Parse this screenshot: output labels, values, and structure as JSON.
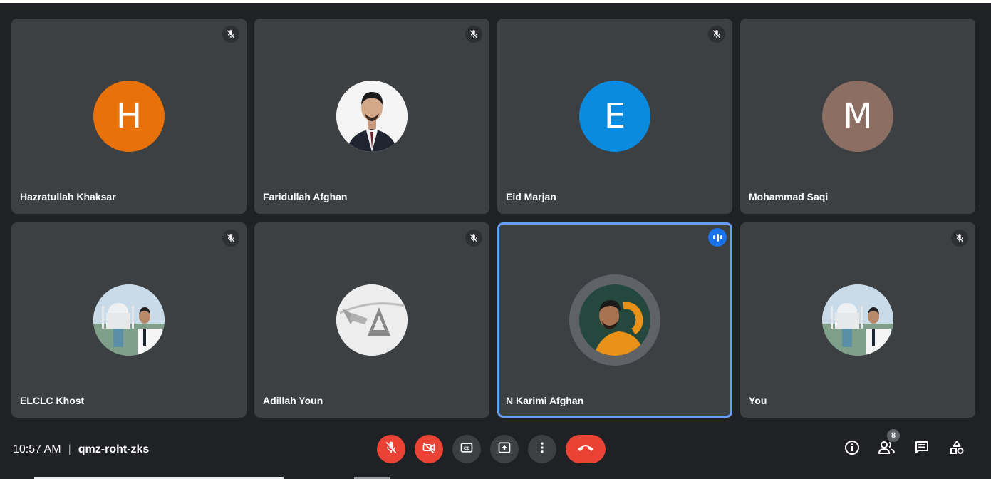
{
  "participants": [
    {
      "name": "Hazratullah Khaksar",
      "initial": "H",
      "avatar_color": "#e8710a",
      "muted": true
    },
    {
      "name": "Faridullah Afghan",
      "initial": "",
      "avatar_color": "#f5f5f5",
      "muted": true
    },
    {
      "name": "Eid Marjan",
      "initial": "E",
      "avatar_color": "#0b8be0",
      "muted": true
    },
    {
      "name": "Mohammad Saqi",
      "initial": "M",
      "avatar_color": "#8d6e63",
      "muted": false
    },
    {
      "name": "ELCLC Khost",
      "initial": "",
      "avatar_color": "#b7cfe0",
      "muted": true
    },
    {
      "name": "Adillah Youn",
      "initial": "",
      "avatar_color": "#ececec",
      "muted": true
    },
    {
      "name": "N Karimi Afghan",
      "initial": "",
      "avatar_color": "#2f6b5a",
      "muted": false,
      "speaking": true
    },
    {
      "name": "You",
      "initial": "",
      "avatar_color": "#b7cfe0",
      "muted": true
    }
  ],
  "meeting": {
    "time": "10:57 AM",
    "separator": "|",
    "code": "qmz-roht-zks"
  },
  "controls": {
    "icons": [
      "mic-off-icon",
      "camera-off-icon",
      "captions-icon",
      "present-icon",
      "more-options-icon",
      "end-call-icon"
    ]
  },
  "right_panel": {
    "people_count": "8",
    "icons": [
      "info-icon",
      "people-icon",
      "chat-icon",
      "activities-icon"
    ]
  },
  "colors": {
    "background": "#202124",
    "tile": "#3c4043",
    "active_border": "#669df6",
    "danger": "#ea4335",
    "speaking": "#1a73e8"
  }
}
